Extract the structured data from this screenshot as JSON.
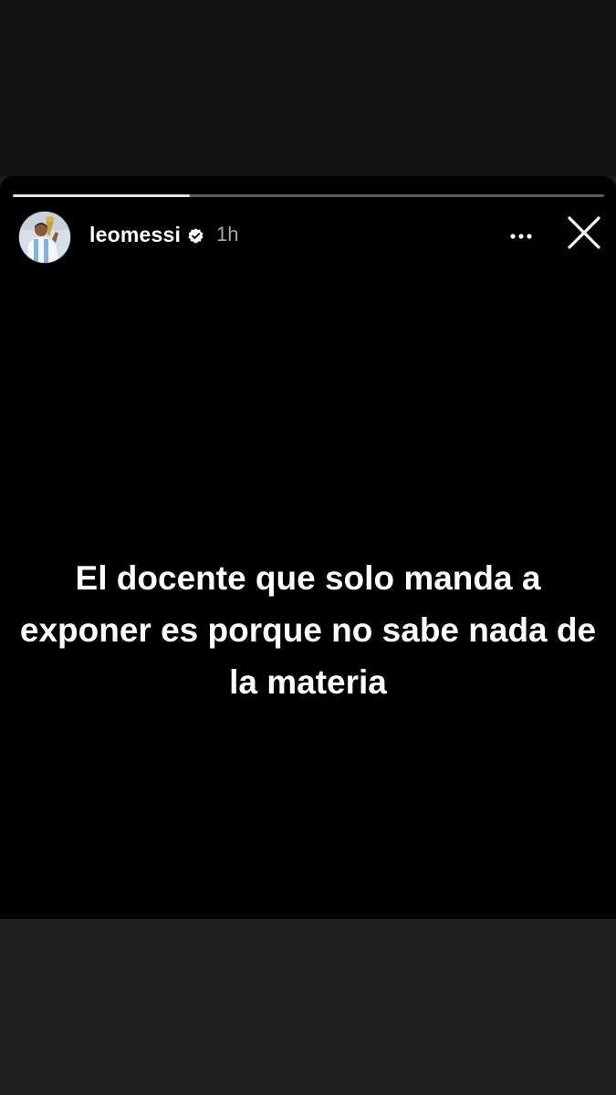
{
  "story": {
    "username": "leomessi",
    "verified": true,
    "timestamp": "1h",
    "progress": 0.3,
    "text": "El docente que solo manda a exponer es porque no sabe nada de la materia"
  },
  "colors": {
    "story_background": "#000000",
    "top_background": "#121212",
    "bottom_background": "#1f1f1f",
    "text": "#ffffff",
    "timestamp": "#a8a8a8"
  },
  "icons": {
    "more": "more-horizontal-icon",
    "close": "close-icon",
    "verified": "verified-badge-icon"
  }
}
